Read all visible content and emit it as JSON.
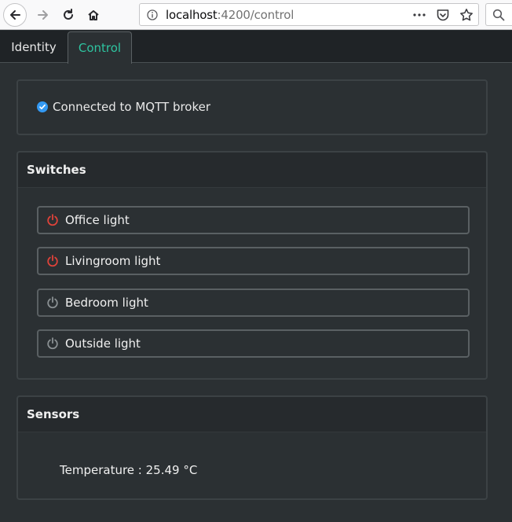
{
  "browser": {
    "url_host": "localhost",
    "url_path": ":4200/control"
  },
  "tabs": [
    {
      "label": "Identity",
      "active": false
    },
    {
      "label": "Control",
      "active": true
    }
  ],
  "status": {
    "text": "Connected to MQTT broker",
    "color": "#3399f3"
  },
  "switches": {
    "title": "Switches",
    "items": [
      {
        "label": "Office light",
        "on": true
      },
      {
        "label": "Livingroom light",
        "on": true
      },
      {
        "label": "Bedroom light",
        "on": false
      },
      {
        "label": "Outside light",
        "on": false
      }
    ],
    "on_color": "#e0433a",
    "off_color": "#8a9093"
  },
  "sensors": {
    "title": "Sensors",
    "temperature_label": "Temperature : ",
    "temperature_value": "25.49",
    "temperature_unit": " °C"
  },
  "colors": {
    "accent": "#2ec4a0",
    "background": "#2b3033"
  }
}
